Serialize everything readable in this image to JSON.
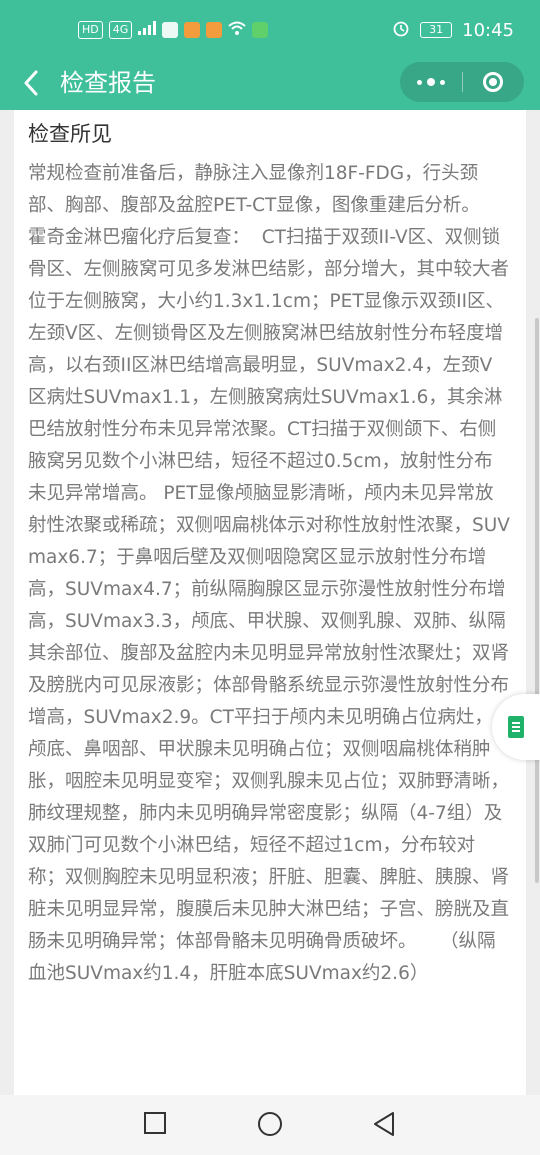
{
  "status_bar": {
    "left_badges": [
      "HD",
      "4G"
    ],
    "battery": "31",
    "time": "10:45",
    "icons": [
      "signal-icon",
      "wechat-icon",
      "video-app-icon",
      "taobao-icon",
      "wifi-icon",
      "play-app-icon",
      "alarm-icon",
      "battery-icon"
    ]
  },
  "header": {
    "title": "检查报告",
    "back_icon": "chevron-left-icon",
    "menu_icon": "more-dots-icon",
    "close_icon": "target-circle-icon"
  },
  "report": {
    "section_title": "检查所见",
    "findings": "常规检查前准备后，静脉注入显像剂18F-FDG，行头颈部、胸部、腹部及盆腔PET-CT显像，图像重建后分析。        霍奇金淋巴瘤化疗后复查：  CT扫描于双颈II-V区、双侧锁骨区、左侧腋窝可见多发淋巴结影，部分增大，其中较大者位于左侧腋窝，大小约1.3x1.1cm；PET显像示双颈II区、左颈V区、左侧锁骨区及左侧腋窝淋巴结放射性分布轻度增高，以右颈II区淋巴结增高最明显，SUVmax2.4，左颈V区病灶SUVmax1.1，左侧腋窝病灶SUVmax1.6，其余淋巴结放射性分布未见异常浓聚。CT扫描于双侧颌下、右侧腋窝另见数个小淋巴结，短径不超过0.5cm，放射性分布未见异常增高。 PET显像颅脑显影清晰，颅内未见异常放射性浓聚或稀疏；双侧咽扁桃体示对称性放射性浓聚，SUVmax6.7；于鼻咽后壁及双侧咽隐窝区显示放射性分布增高，SUVmax4.7；前纵隔胸腺区显示弥漫性放射性分布增高，SUVmax3.3，颅底、甲状腺、双侧乳腺、双肺、纵隔其余部位、腹部及盆腔内未见明显异常放射性浓聚灶；双肾及膀胱内可见尿液影；体部骨骼系统显示弥漫性放射性分布增高，SUVmax2.9。CT平扫于颅内未见明确占位病灶，颅底、鼻咽部、甲状腺未见明确占位；双侧咽扁桃体稍肿胀，咽腔未见明显变窄；双侧乳腺未见占位；双肺野清晰，肺纹理规整，肺内未见明确异常密度影；纵隔（4-7组）及双肺门可见数个小淋巴结，短径不超过1cm，分布较对称；双侧胸腔未见明显积液；肝脏、胆囊、脾脏、胰腺、肾脏未见明显异常，腹膜后未见肿大淋巴结；子宫、膀胱及直肠未见明确异常；体部骨骼未见明确骨质破坏。    （纵隔血池SUVmax约1.4，肝脏本底SUVmax约2.6）"
  },
  "floating_button": {
    "icon": "document-icon"
  },
  "nav_bar": {
    "icons": [
      "square-recents-icon",
      "circle-home-icon",
      "triangle-back-icon"
    ]
  },
  "colors": {
    "header_bg": "#3fbf9a",
    "text_gray": "#7a7a7a",
    "accent_green": "#1fb26b"
  }
}
